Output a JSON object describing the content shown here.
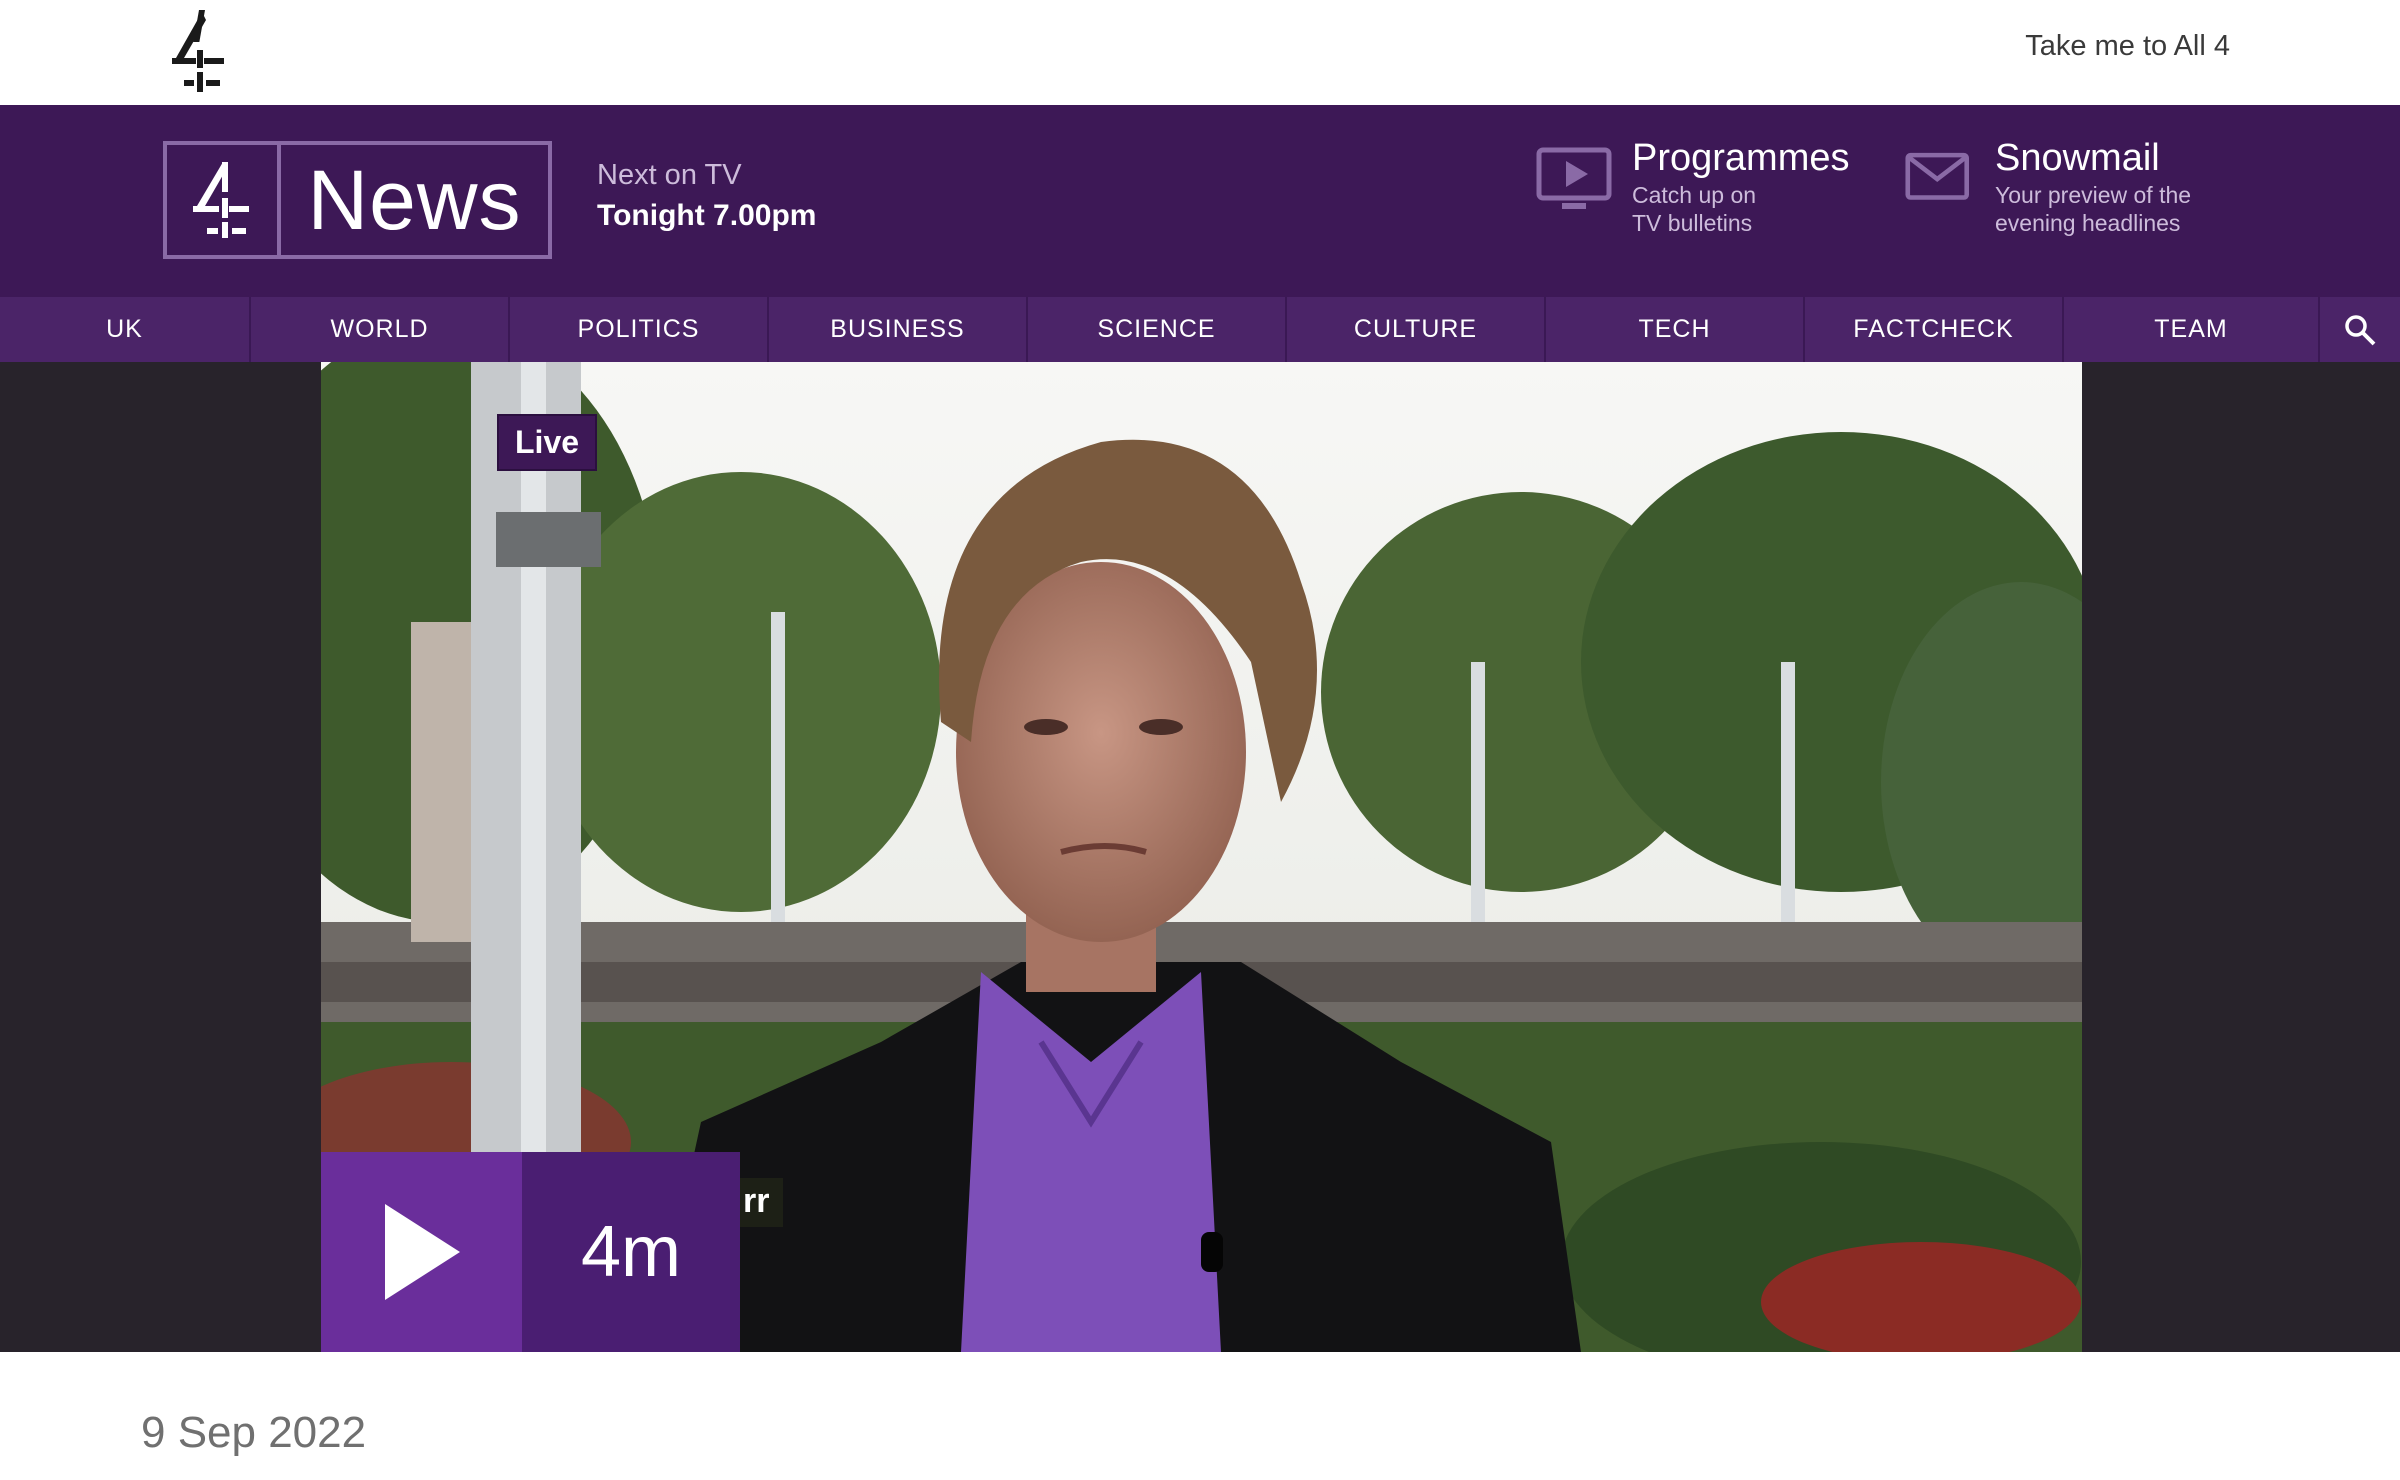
{
  "topbar": {
    "all4_link": "Take me to All 4"
  },
  "brand": {
    "word": "News"
  },
  "next_on_tv": {
    "label": "Next on TV",
    "time": "Tonight 7.00pm"
  },
  "promos": [
    {
      "title": "Programmes",
      "sub_line1": "Catch up on",
      "sub_line2": "TV bulletins",
      "icon": "tv-play-icon"
    },
    {
      "title": "Snowmail",
      "sub_line1": "Your preview of the",
      "sub_line2": "evening headlines",
      "icon": "envelope-icon"
    }
  ],
  "nav": {
    "items": [
      "UK",
      "WORLD",
      "POLITICS",
      "BUSINESS",
      "SCIENCE",
      "CULTURE",
      "TECH",
      "FACTCHECK",
      "TEAM"
    ],
    "search_icon": "search-icon"
  },
  "video": {
    "live_label": "Live",
    "strap_text": "rr",
    "duration": "4m",
    "play_icon": "play-icon"
  },
  "article": {
    "date": "9 Sep 2022"
  },
  "colors": {
    "header_purple": "#3d1856",
    "nav_purple": "#4b2468",
    "play_purple": "#6a2e9b",
    "duration_purple": "#4a1e72",
    "hero_bg": "#28232b"
  }
}
